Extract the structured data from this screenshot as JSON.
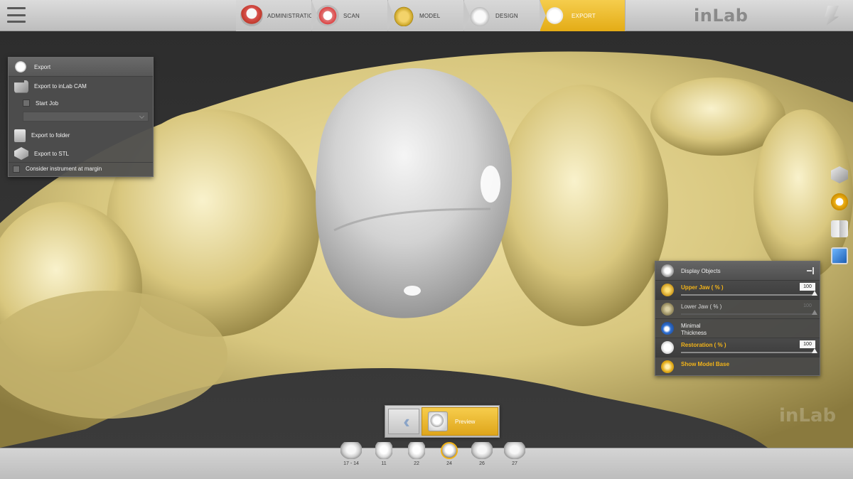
{
  "app": {
    "logo": "inLab",
    "watermark": "inLab"
  },
  "steps": [
    {
      "label": "ADMINISTRATION",
      "icon": "administration-icon",
      "active": false
    },
    {
      "label": "SCAN",
      "icon": "scan-icon",
      "active": false
    },
    {
      "label": "MODEL",
      "icon": "model-icon",
      "active": false
    },
    {
      "label": "DESIGN",
      "icon": "design-icon",
      "active": false
    },
    {
      "label": "EXPORT",
      "icon": "export-icon",
      "active": true
    }
  ],
  "export_panel": {
    "title": "Export",
    "export_cam": "Export to inLab CAM",
    "start_job": "Start Job",
    "export_folder": "Export to folder",
    "export_stl": "Export to STL",
    "consider_margin": "Consider instrument at margin"
  },
  "display_panel": {
    "title": "Display Objects",
    "rows": [
      {
        "label": "Upper Jaw  ( % )",
        "value": "100"
      },
      {
        "label": "Lower Jaw  ( % )",
        "value": "100"
      },
      {
        "label": "Minimal\nThickness"
      },
      {
        "label": "Restoration  ( % )",
        "value": "100"
      },
      {
        "label": "Show Model Base"
      }
    ]
  },
  "bottom": {
    "preview_label": "Preview",
    "teeth": [
      "17 - 14",
      "11",
      "22",
      "24",
      "26",
      "27"
    ],
    "active_tooth": "24"
  },
  "colors": {
    "accent": "#f0b318",
    "jaw": "#d6c88a",
    "restoration": "#d9d9d9"
  }
}
